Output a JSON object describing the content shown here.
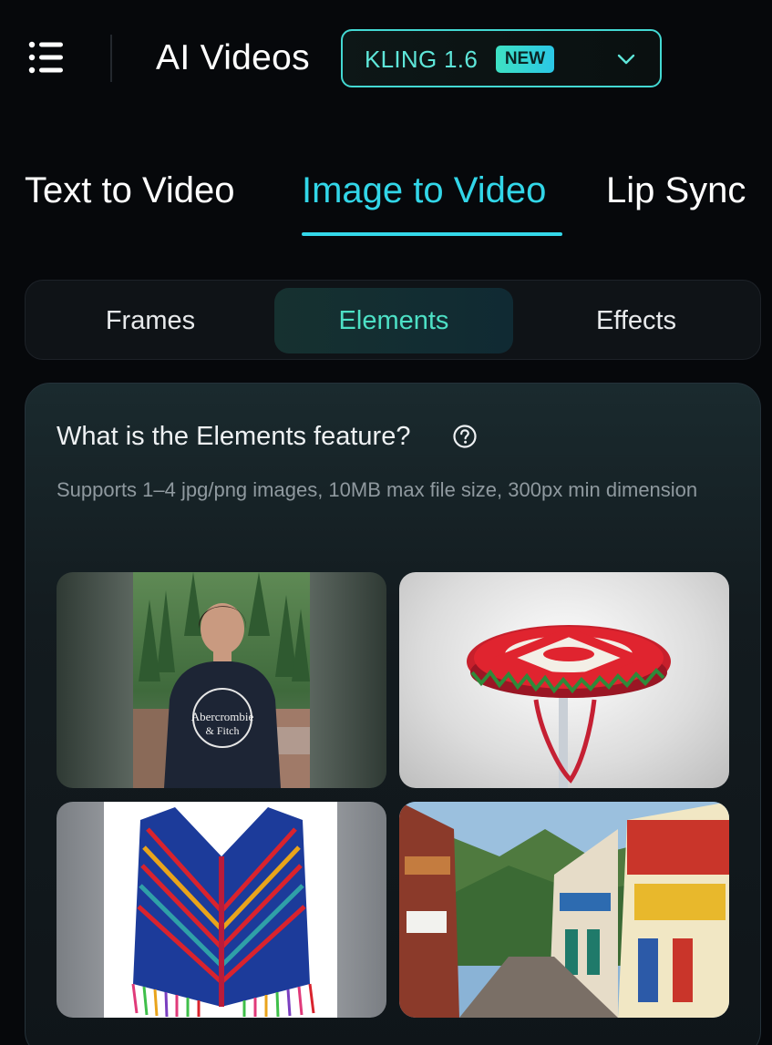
{
  "header": {
    "title": "AI Videos",
    "model": "KLING 1.6",
    "badge": "NEW"
  },
  "tabs": [
    {
      "label": "Text to Video",
      "active": false
    },
    {
      "label": "Image to Video",
      "active": true
    },
    {
      "label": "Lip Sync",
      "active": false
    }
  ],
  "segments": [
    {
      "label": "Frames",
      "active": false
    },
    {
      "label": "Elements",
      "active": true
    },
    {
      "label": "Effects",
      "active": false
    }
  ],
  "feature": {
    "title": "What is the Elements feature?",
    "description": "Supports 1–4 jpg/png images, 10MB max file size, 300px min dimension"
  },
  "samples": {
    "shirt_text_1": "Abercrombie",
    "shirt_text_2": "& Fitch"
  },
  "colors": {
    "accent": "#34d8ea",
    "accent_green": "#4de0c5",
    "background": "#06080b"
  }
}
